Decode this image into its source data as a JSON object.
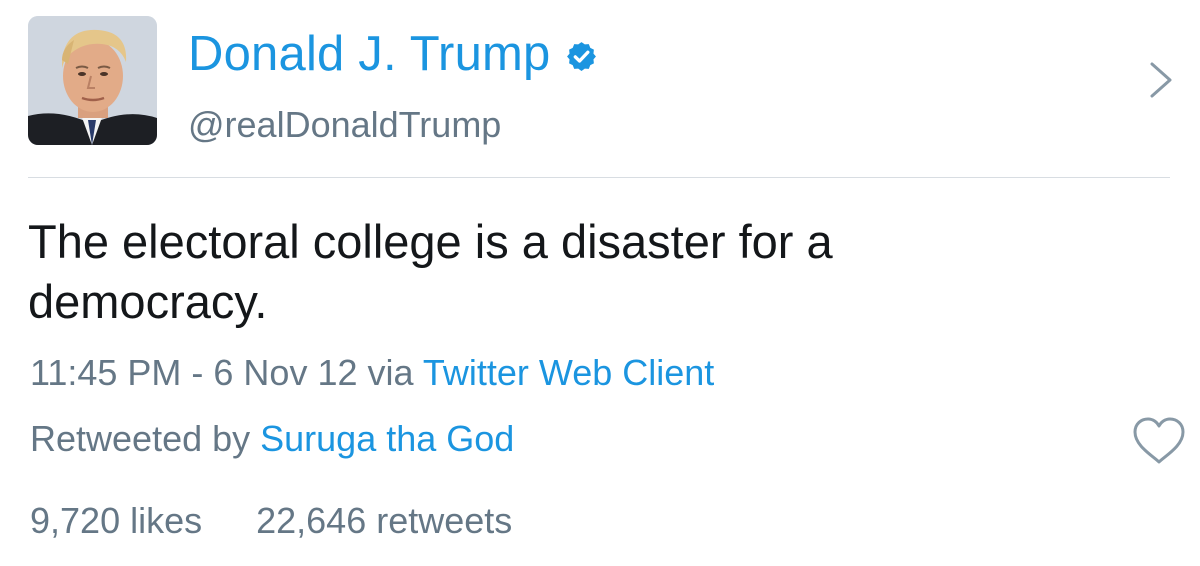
{
  "header": {
    "display_name": "Donald J. Trump",
    "handle": "@realDonaldTrump",
    "verified_icon": "verified-badge-icon",
    "avatar_icon": "profile-photo",
    "chevron_icon": "chevron-right-icon"
  },
  "tweet": {
    "text_line1": "The electoral college is a disaster for a",
    "text_line2": "democracy.",
    "time": "11:45 PM - 6 Nov 12 via ",
    "client": "Twitter Web Client",
    "retweeted_prefix": "Retweeted by ",
    "retweeted_by": "Suruga tha God",
    "likes": "9,720 likes",
    "retweets": "22,646 retweets",
    "like_icon": "heart-outline-icon"
  },
  "colors": {
    "accent": "#1b95e0",
    "text": "#14171a",
    "secondary": "#657786"
  }
}
